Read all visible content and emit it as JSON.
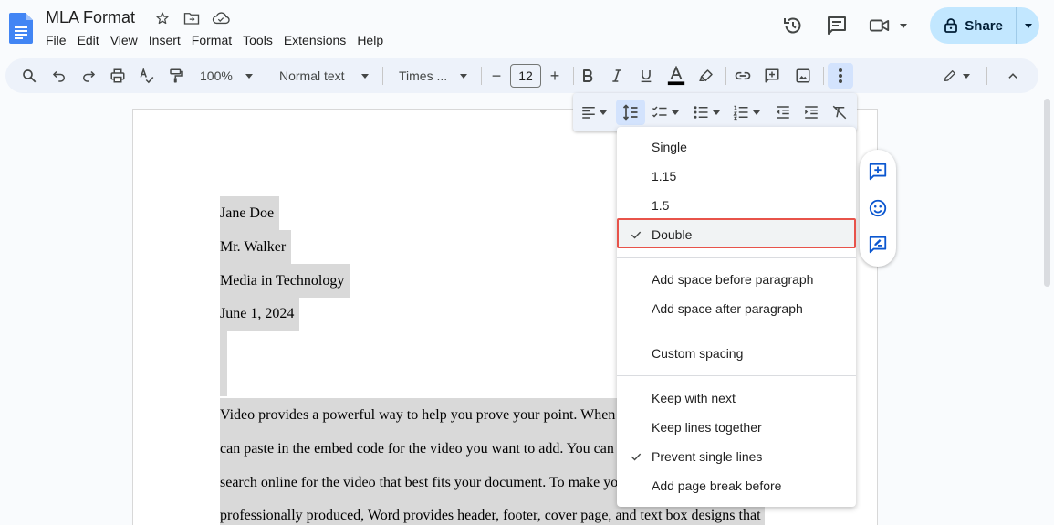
{
  "app": {
    "title": "MLA Format",
    "menu": [
      "File",
      "Edit",
      "View",
      "Insert",
      "Format",
      "Tools",
      "Extensions",
      "Help"
    ],
    "share_label": "Share"
  },
  "toolbar": {
    "zoom": "100%",
    "style": "Normal text",
    "font": "Times ...",
    "font_size": "12",
    "decrease_label": "−",
    "increase_label": "+"
  },
  "document": {
    "lines": [
      "Jane Doe",
      "Mr. Walker",
      "Media in Technology",
      "June 1, 2024",
      "Video provides a powerful way to help you prove your point. When",
      "can paste in the embed code for the video you want to add. You can",
      "search online for the video that best fits your document. To make yo",
      "professionally produced, Word provides header, footer, cover page, and text box designs that"
    ]
  },
  "line_spacing_menu": {
    "spacing_options": [
      {
        "label": "Single",
        "checked": false
      },
      {
        "label": "1.15",
        "checked": false
      },
      {
        "label": "1.5",
        "checked": false
      },
      {
        "label": "Double",
        "checked": true
      }
    ],
    "paragraph_options": [
      "Add space before paragraph",
      "Add space after paragraph"
    ],
    "custom": "Custom spacing",
    "pagination_options": [
      {
        "label": "Keep with next",
        "checked": false
      },
      {
        "label": "Keep lines together",
        "checked": false
      },
      {
        "label": "Prevent single lines",
        "checked": true
      },
      {
        "label": "Add page break before",
        "checked": false
      }
    ]
  },
  "colors": {
    "accent": "#0b57d0",
    "share_bg": "#c2e7ff",
    "highlight_border": "#e8534a",
    "selection": "#d9d9d9"
  },
  "icons": {
    "side_float": [
      "add-comment-icon",
      "emoji-icon",
      "suggest-edits-icon"
    ]
  }
}
